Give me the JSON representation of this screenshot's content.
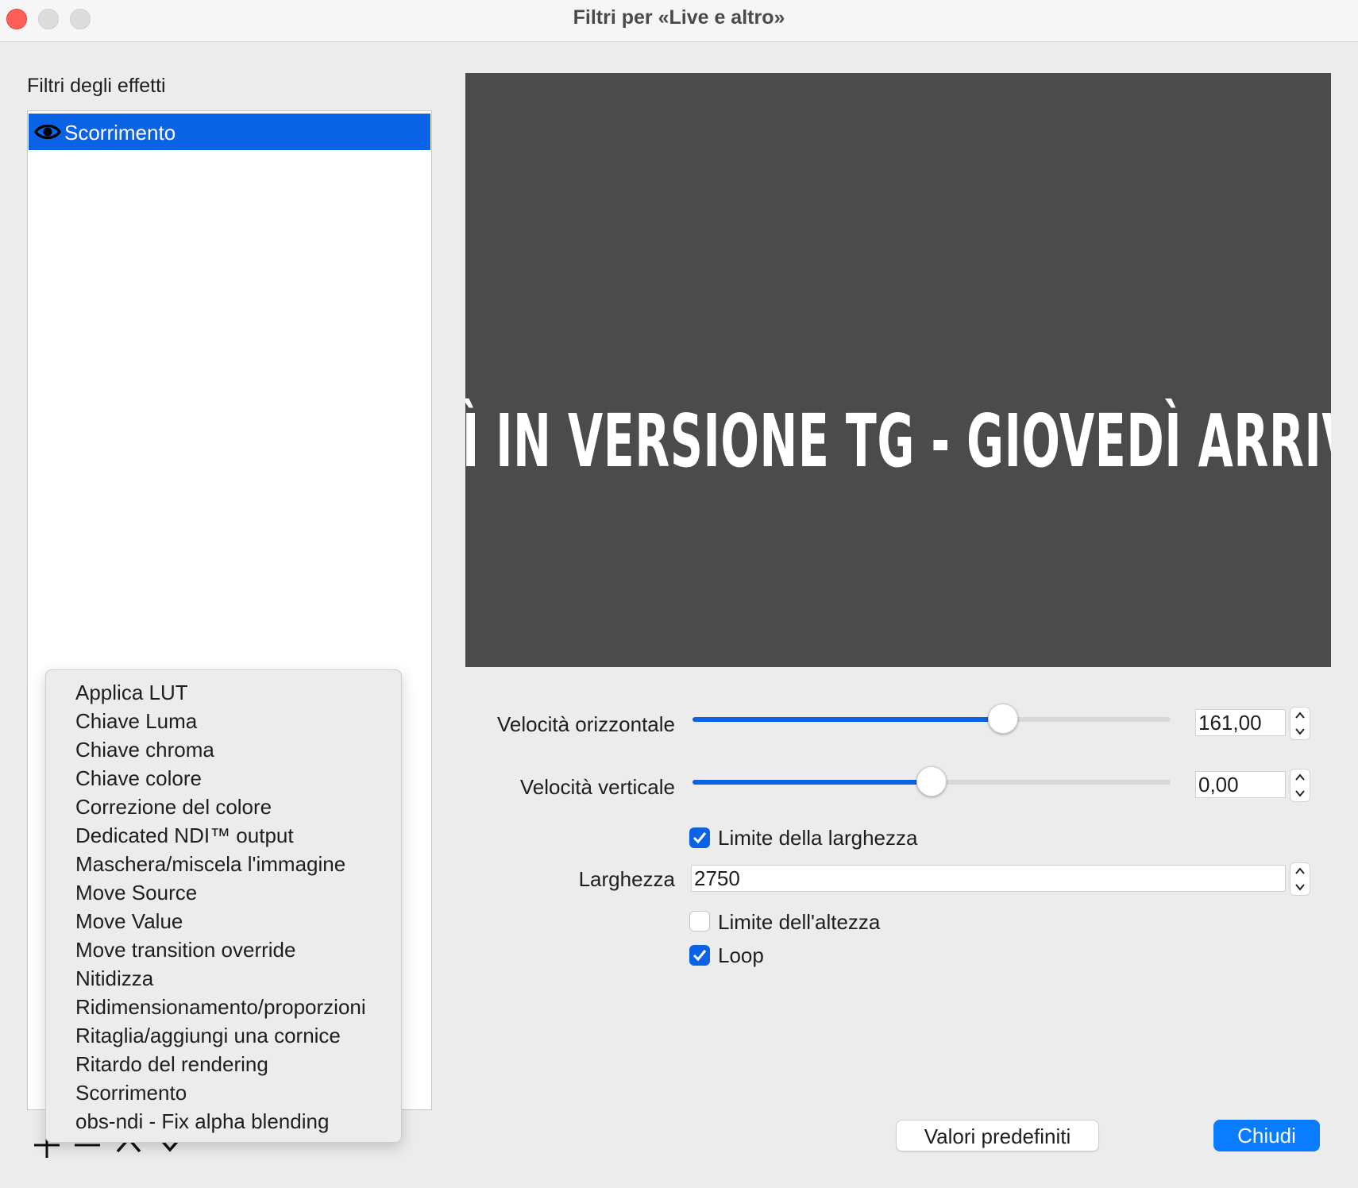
{
  "window": {
    "title": "Filtri per «Live e altro»"
  },
  "filters_panel": {
    "label": "Filtri degli effetti",
    "items": [
      {
        "label": "Scorrimento",
        "visible": true,
        "selected": true
      }
    ]
  },
  "preview": {
    "text": "DÌ IN VERSIONE TG   -  GIOVEDÌ ARRIV"
  },
  "properties": {
    "h_speed": {
      "label": "Velocità orizzontale",
      "value": "161,00",
      "slider_fraction": 0.65
    },
    "v_speed": {
      "label": "Velocità verticale",
      "value": "0,00",
      "slider_fraction": 0.5
    },
    "limit_width": {
      "label": "Limite della larghezza",
      "checked": true
    },
    "width": {
      "label": "Larghezza",
      "value": "2750"
    },
    "limit_height": {
      "label": "Limite dell'altezza",
      "checked": false
    },
    "loop": {
      "label": "Loop",
      "checked": true
    }
  },
  "add_filter_menu": {
    "items": [
      "Applica LUT",
      "Chiave Luma",
      "Chiave chroma",
      "Chiave colore",
      "Correzione del colore",
      "Dedicated NDI™ output",
      "Maschera/miscela l'immagine",
      "Move Source",
      "Move Value",
      "Move transition override",
      "Nitidizza",
      "Ridimensionamento/proporzioni",
      "Ritaglia/aggiungi una cornice",
      "Ritardo del rendering",
      "Scorrimento",
      "obs-ndi - Fix alpha blending"
    ]
  },
  "buttons": {
    "defaults": "Valori predefiniti",
    "close": "Chiudi"
  },
  "colors": {
    "accent": "#0a63e4",
    "preview_bg": "#4b4b4b",
    "window_bg": "#ececec"
  },
  "icons": [
    "eye-icon",
    "plus-icon",
    "minus-icon",
    "chevron-up-icon",
    "chevron-down-icon",
    "checkmark-icon"
  ]
}
